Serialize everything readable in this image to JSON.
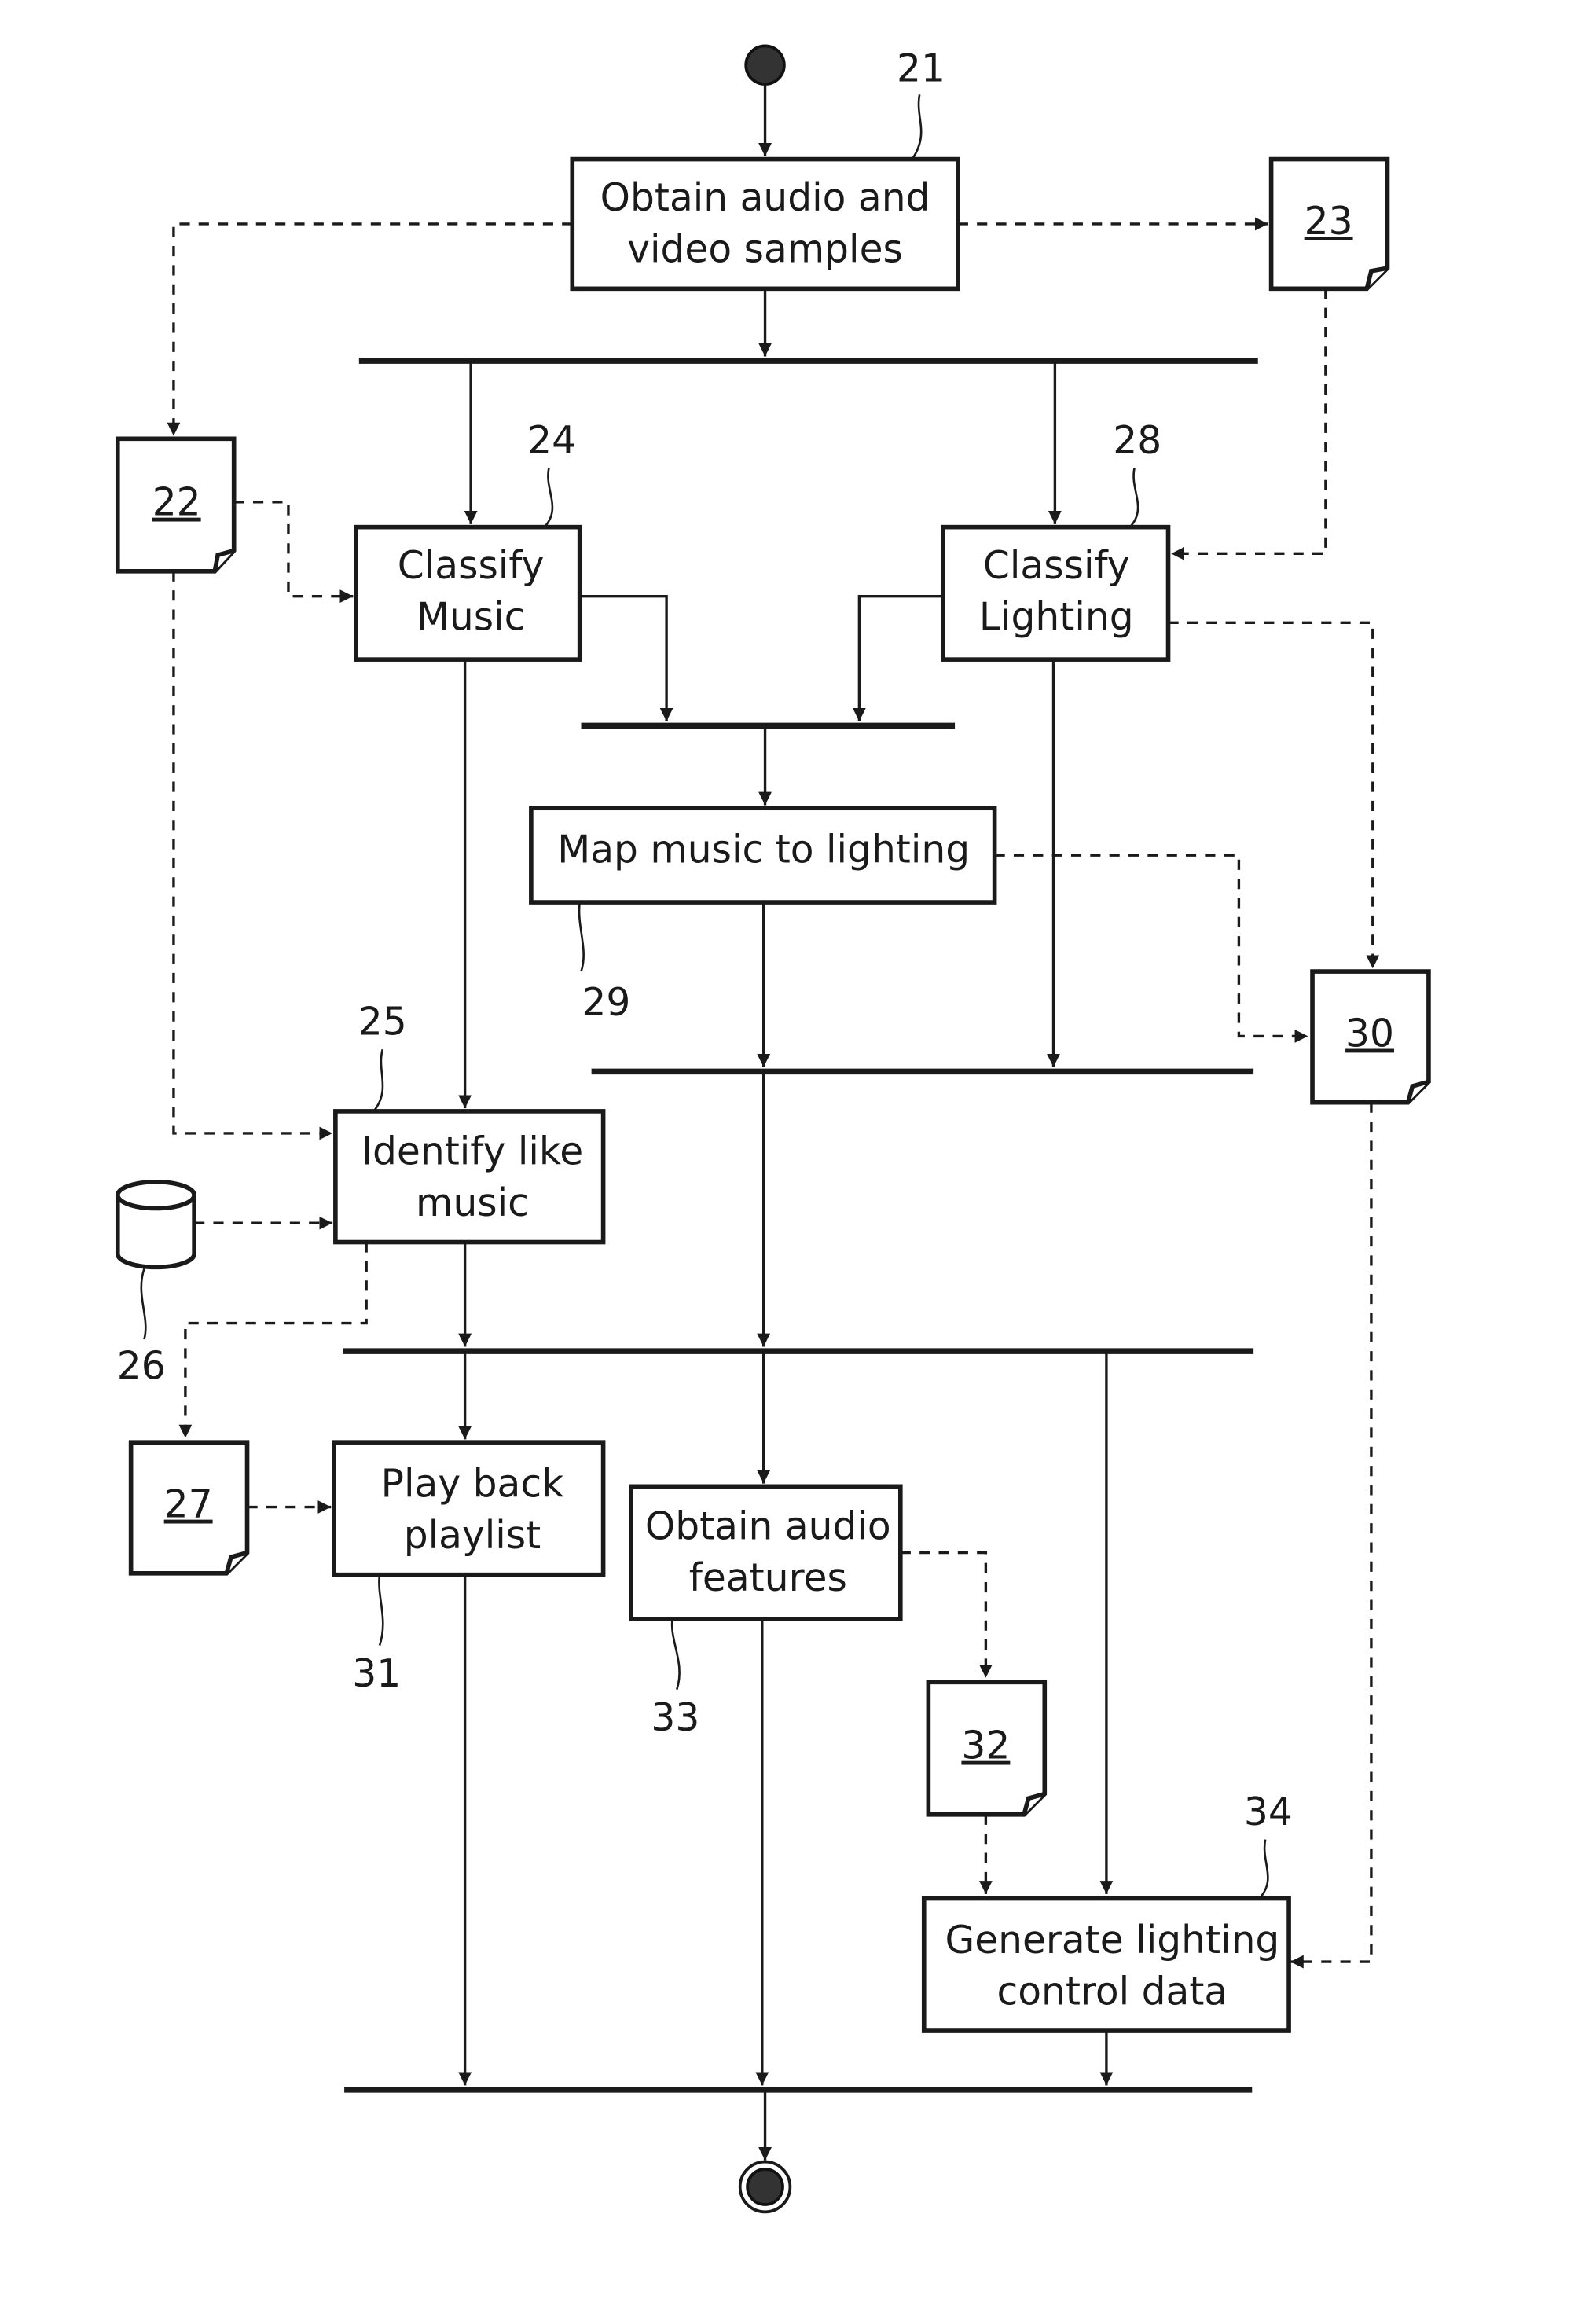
{
  "diagram": {
    "type": "activity-flowchart",
    "steps": {
      "s21": {
        "ref": "21",
        "lines": [
          "Obtain audio and",
          "video samples"
        ]
      },
      "s24": {
        "ref": "24",
        "lines": [
          "Classify",
          "Music"
        ]
      },
      "s28": {
        "ref": "28",
        "lines": [
          "Classify",
          "Lighting"
        ]
      },
      "s29": {
        "ref": "29",
        "lines": [
          "Map music to lighting"
        ]
      },
      "s25": {
        "ref": "25",
        "lines": [
          "Identify like",
          "music"
        ]
      },
      "s31": {
        "ref": "31",
        "lines": [
          "Play back",
          "playlist"
        ]
      },
      "s33": {
        "ref": "33",
        "lines": [
          "Obtain audio",
          "features"
        ]
      },
      "s34": {
        "ref": "34",
        "lines": [
          "Generate lighting",
          "control data"
        ]
      }
    },
    "documents": {
      "d22": {
        "ref": "22"
      },
      "d23": {
        "ref": "23"
      },
      "d27": {
        "ref": "27"
      },
      "d30": {
        "ref": "30"
      },
      "d32": {
        "ref": "32"
      }
    },
    "database": {
      "ref": "26"
    },
    "start_node": "start",
    "end_node": "end"
  }
}
